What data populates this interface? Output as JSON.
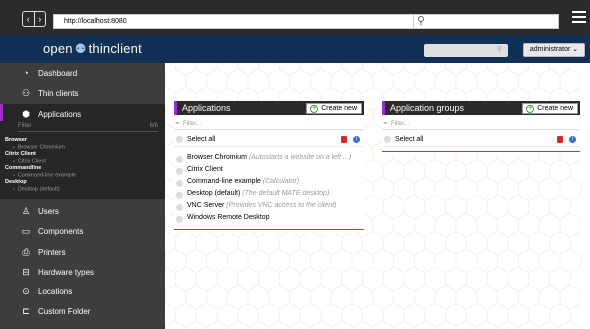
{
  "browser": {
    "url": "http://localhost:8080",
    "back_glyph": "‹",
    "forward_glyph": "›",
    "go_glyph": "→",
    "search_glyph": "⚲"
  },
  "header": {
    "logo_open": "open",
    "logo_icon": "⚉",
    "logo_rest": "thinclient",
    "search_glyph": "⚲",
    "user_menu": "administrator ⌄"
  },
  "sidebar": {
    "items": [
      {
        "label": "Dashboard",
        "icon": "◔",
        "icon_name": "dashboard-icon"
      },
      {
        "label": "Thin clients",
        "icon": "⚇",
        "icon_name": "users-icon"
      },
      {
        "label": "Applications",
        "icon": "⬢",
        "icon_name": "cube-icon"
      }
    ],
    "lower_items": [
      {
        "label": "Users",
        "icon": "♙",
        "icon_name": "user-icon"
      },
      {
        "label": "Components",
        "icon": "▭",
        "icon_name": "monitor-icon"
      },
      {
        "label": "Printers",
        "icon": "⎙",
        "icon_name": "printer-icon"
      },
      {
        "label": "Hardware types",
        "icon": "⊟",
        "icon_name": "hardware-icon"
      },
      {
        "label": "Locations",
        "icon": "⊙",
        "icon_name": "location-icon"
      },
      {
        "label": "Custom Folder",
        "icon": "⊏",
        "icon_name": "folder-icon"
      }
    ],
    "sub_filter_placeholder": "Filter",
    "sub_filter_count": "6/6",
    "tree": [
      {
        "label": "Browser",
        "type": "group"
      },
      {
        "label": "Browser Chromium",
        "type": "sub"
      },
      {
        "label": "Citrix Client",
        "type": "group"
      },
      {
        "label": "Citrix Client",
        "type": "sub"
      },
      {
        "label": "Commandline",
        "type": "group"
      },
      {
        "label": "Command-line example",
        "type": "sub"
      },
      {
        "label": "Desktop",
        "type": "group"
      },
      {
        "label": "Desktop (default)",
        "type": "sub"
      }
    ]
  },
  "applications_panel": {
    "title": "Applications",
    "new_button": "Create new",
    "filter_placeholder": "Filter...",
    "select_all": "Select all",
    "items": [
      {
        "name": "Browser Chromium",
        "desc": "(Autostarts a website on a left ...)"
      },
      {
        "name": "Citrix Client",
        "desc": ""
      },
      {
        "name": "Command-line example",
        "desc": "(Calculator)"
      },
      {
        "name": "Desktop (default)",
        "desc": "(The default MATE desktop)"
      },
      {
        "name": "VNC Server",
        "desc": "(Provides VNC access to the client)"
      },
      {
        "name": "Windows Remote Desktop",
        "desc": ""
      }
    ]
  },
  "groups_panel": {
    "title": "Application groups",
    "new_button": "Create new",
    "filter_placeholder": "Filter...",
    "select_all": "Select all"
  },
  "colors": {
    "accent": "#a12cd0",
    "header_bg": "#113055",
    "sidebar_bg": "#3d3d3d",
    "panel_head": "#2b2b2b"
  }
}
